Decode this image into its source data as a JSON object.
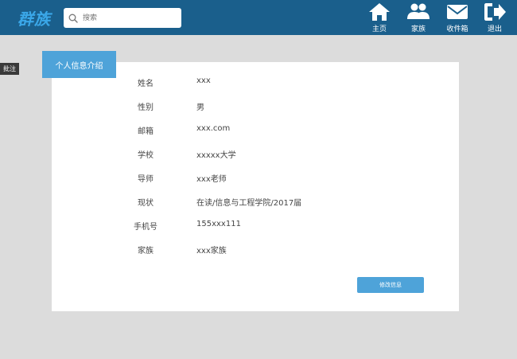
{
  "header": {
    "logo": "群族",
    "search": {
      "placeholder": "搜索"
    },
    "nav": [
      {
        "label": "主页",
        "icon": "home-icon"
      },
      {
        "label": "家族",
        "icon": "users-icon"
      },
      {
        "label": "收件箱",
        "icon": "mail-icon"
      },
      {
        "label": "退出",
        "icon": "logout-icon"
      }
    ]
  },
  "side_tag": "批注",
  "profile": {
    "tab_label": "个人信息介绍",
    "fields": [
      {
        "label": "姓名",
        "value": "xxx"
      },
      {
        "label": "性别",
        "value": "男"
      },
      {
        "label": "邮箱",
        "value": "xxx.com"
      },
      {
        "label": "学校",
        "value": "xxxxx大学"
      },
      {
        "label": "导师",
        "value": "xxx老师"
      },
      {
        "label": "现状",
        "value": "在读/信息与工程学院/2017届"
      },
      {
        "label": "手机号",
        "value": "155xxx111"
      },
      {
        "label": "家族",
        "value": "xxx家族"
      }
    ],
    "edit_button": "修改信息"
  }
}
